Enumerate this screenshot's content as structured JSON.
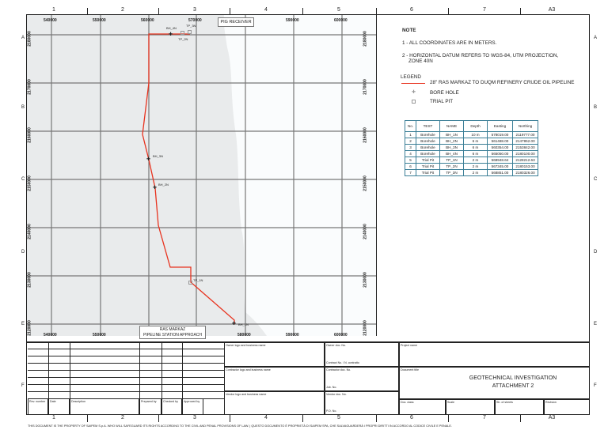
{
  "frame": {
    "columns": [
      "1",
      "2",
      "3",
      "4",
      "5",
      "6",
      "7",
      "A3"
    ],
    "rows": [
      "A",
      "B",
      "C",
      "D",
      "E",
      "F"
    ]
  },
  "map": {
    "easting_labels": [
      "540000",
      "550000",
      "560000",
      "570000",
      "580000",
      "590000",
      "600000"
    ],
    "northing_labels": [
      "2180000",
      "2170000",
      "2160000",
      "2150000",
      "2140000",
      "2130000",
      "2120000"
    ],
    "callouts": {
      "pig_receiver": "PIG RECEIVER",
      "station_line1": "RAS MARKAZ",
      "station_line2": "PIPELINE STATION APPROACH"
    },
    "points": [
      {
        "name": "BH_4N",
        "type": "bore"
      },
      {
        "name": "TP_3N",
        "type": "pit"
      },
      {
        "name": "TP_2N",
        "type": "pit"
      },
      {
        "name": "BH_3N",
        "type": "bore"
      },
      {
        "name": "BH_2N",
        "type": "bore"
      },
      {
        "name": "TP_1N",
        "type": "pit"
      },
      {
        "name": "BH_1N",
        "type": "bore"
      }
    ],
    "colors": {
      "land": "#e9ebec",
      "sea": "#fafcfd",
      "pipeline": "#e8321e",
      "grid": "#777777"
    }
  },
  "notes": {
    "title": "NOTE",
    "items": [
      "1 - ALL COORDINATES ARE IN METERS.",
      "2 - HORIZONTAL DATUM REFERS TO WGS-84, UTM PROJECTION,",
      "ZONE 40N"
    ],
    "legend_title": "LEGEND",
    "legend": [
      "28\" RAS MARKAZ TO DUQM REFINERY CRUDE OIL PIPELINE",
      "BORE HOLE",
      "TRIAL PIT"
    ]
  },
  "survey_table": {
    "headers": [
      "No.",
      "TEST",
      "NAME",
      "Depth",
      "Easting",
      "Northing"
    ],
    "rows": [
      [
        "1",
        "Borehole",
        "BH_1N",
        "10 m",
        "578019.00",
        "2119777.00"
      ],
      [
        "2",
        "Borehole",
        "BH_2N",
        "6 m",
        "561488.00",
        "2147952.00"
      ],
      [
        "3",
        "Borehole",
        "BH_3N",
        "6 m",
        "560354.00",
        "2153842.00"
      ],
      [
        "4",
        "Borehole",
        "BH_4N",
        "6 m",
        "565050.00",
        "2180100.00"
      ],
      [
        "5",
        "Trial Pit",
        "TP_1N",
        "2 m",
        "568948.64",
        "2128212.63"
      ],
      [
        "6",
        "Trial Pit",
        "TP_2N",
        "2 m",
        "567345.00",
        "2180153.00"
      ],
      [
        "7",
        "Trial Pit",
        "TP_3N",
        "2 m",
        "568851.00",
        "2180326.00"
      ]
    ]
  },
  "title_block": {
    "rev_headers": [
      "Rev. number",
      "Date",
      "Description",
      "Prepared by",
      "Checked by",
      "Approved by"
    ],
    "owner_logo": "Owner logo and business name",
    "owner_doc": "Owner doc. No.",
    "contract": "Contract No. / N. contratto",
    "contractor_logo": "Contractor logo and business name",
    "contractor_doc": "Contractor doc. No.",
    "job": "Job. No.",
    "vendor_logo": "Vendor logo and business name",
    "vendor_doc": "Vendor doc. No.",
    "po": "P.O. No.",
    "project_name": "Project name",
    "document_title_label": "Document title",
    "title_line1": "GEOTECHNICAL INVESTIGATION",
    "title_line2": "ATTACHMENT 2",
    "doc_class": "Doc. class",
    "scale": "Scale",
    "sheets": "Sh. of sheets",
    "revision": "Revision"
  },
  "footer": "THIS DOCUMENT IS THE PROPERTY OF SAIPEM S.p.A. WHO WILL SAFEGUARD ITS RIGHTS ACCORDING TO THE CIVIL AND PENAL PROVISIONS OF LAW. | QUESTO DOCUMENTO È PROPRIETÀ DI SAIPEM SPA, CHE SALVAGUARDERÀ I PROPRI DIRITTI IN ACCORDO AL CODICE CIVILE E PENALE."
}
